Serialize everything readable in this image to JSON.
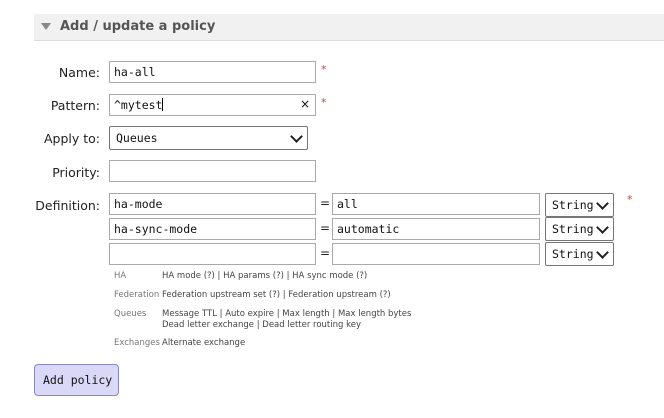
{
  "section": {
    "title": "Add / update a policy"
  },
  "form": {
    "name_label": "Name:",
    "name_value": "ha-all",
    "pattern_label": "Pattern:",
    "pattern_value": "^mytest",
    "apply_label": "Apply to:",
    "apply_value": "Queues",
    "priority_label": "Priority:",
    "priority_value": "",
    "definition_label": "Definition:",
    "required_mark": "*",
    "clear_icon": "×"
  },
  "definitions": [
    {
      "key": "ha-mode",
      "eq": "=",
      "value": "all",
      "type": "String"
    },
    {
      "key": "ha-sync-mode",
      "eq": "=",
      "value": "automatic",
      "type": "String"
    },
    {
      "key": "",
      "eq": "=",
      "value": "",
      "type": "String"
    }
  ],
  "help": [
    {
      "category": "HA",
      "links": "HA mode (?) | HA params (?) | HA sync mode (?)"
    },
    {
      "category": "Federation",
      "links": "Federation upstream set (?) | Federation upstream (?)"
    },
    {
      "category": "Queues",
      "links": "Message TTL | Auto expire | Max length | Max length bytes",
      "links2": "Dead letter exchange | Dead letter routing key"
    },
    {
      "category": "Exchanges",
      "links": "Alternate exchange"
    }
  ],
  "button": {
    "add_label": "Add policy"
  }
}
